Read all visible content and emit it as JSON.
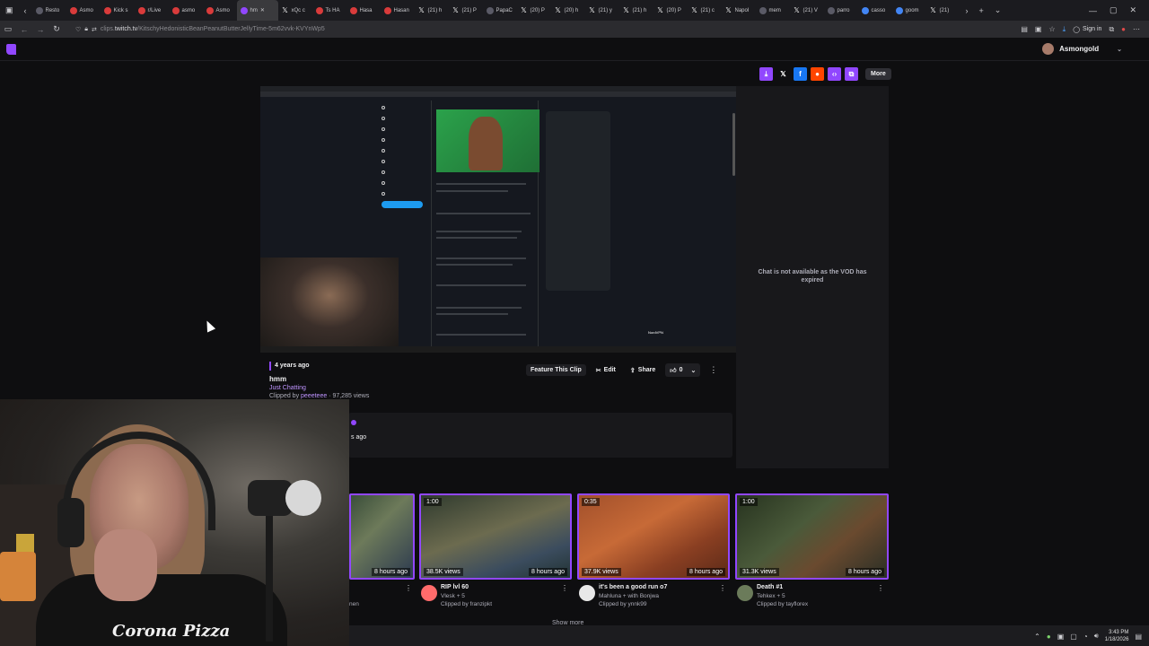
{
  "browser": {
    "tabs": [
      {
        "label": "Resto",
        "icon": "generic"
      },
      {
        "label": "Asmo",
        "icon": "youtube"
      },
      {
        "label": "Kick s",
        "icon": "youtube"
      },
      {
        "label": "r/Live",
        "icon": "youtube"
      },
      {
        "label": "asmo",
        "icon": "youtube"
      },
      {
        "label": "Asmo",
        "icon": "youtube"
      },
      {
        "label": "hm",
        "icon": "twitch",
        "active": true
      },
      {
        "label": "xQc c",
        "icon": "x"
      },
      {
        "label": "Ts HA",
        "icon": "youtube"
      },
      {
        "label": "Hasa",
        "icon": "youtube"
      },
      {
        "label": "Hasan",
        "icon": "youtube"
      },
      {
        "label": "(21) h",
        "icon": "x"
      },
      {
        "label": "(21) P",
        "icon": "x"
      },
      {
        "label": "PapaC",
        "icon": "generic"
      },
      {
        "label": "(20) P",
        "icon": "x"
      },
      {
        "label": "(20) h",
        "icon": "x"
      },
      {
        "label": "(21) y",
        "icon": "x"
      },
      {
        "label": "(21) h",
        "icon": "x"
      },
      {
        "label": "(20) P",
        "icon": "x"
      },
      {
        "label": "(21) c",
        "icon": "x"
      },
      {
        "label": "Napol",
        "icon": "x"
      },
      {
        "label": "mem",
        "icon": "generic"
      },
      {
        "label": "(21) V",
        "icon": "x"
      },
      {
        "label": "parro",
        "icon": "generic"
      },
      {
        "label": "casso",
        "icon": "google"
      },
      {
        "label": "goom",
        "icon": "google"
      },
      {
        "label": "(21)",
        "icon": "x"
      }
    ],
    "url_host": "clips.twitch.tv",
    "url_path": "/KitschyHedonisticBeanPeanutButterJellyTime-5m62vvk-KVYnWp5",
    "url_prefix": "clips.",
    "url_host_main": "twitch.tv",
    "sign_in_label": "Sign in"
  },
  "twitch": {
    "username": "Asmongold",
    "share_more_label": "More"
  },
  "clip": {
    "time_ago": "4 years ago",
    "title": "hmm",
    "category": "Just Chatting",
    "clipped_prefix": "Clipped by ",
    "clipper": "peeeteee",
    "views_text": " · 97,285 views",
    "actions": {
      "feature": "Feature This Clip",
      "edit": "Edit",
      "share": "Share",
      "likes": "0"
    }
  },
  "chat": {
    "message": "Chat is not available as the VOD has expired"
  },
  "comment": {
    "time_ago": "s ago"
  },
  "video": {
    "nordvpn": "NordVPN"
  },
  "clips": [
    {
      "duration": "",
      "views": "",
      "hours": "8 hours ago",
      "title": "",
      "streamer": "",
      "clipper": "nen"
    },
    {
      "duration": "1:00",
      "views": "38.5K views",
      "hours": "8 hours ago",
      "title": "RIP lvl 60",
      "streamer": "Vlesk + 5",
      "clipper": "Clipped by franzipkt"
    },
    {
      "duration": "0:35",
      "views": "37.9K views",
      "hours": "8 hours ago",
      "title": "it's been a good run o7",
      "streamer": "Mahluna + with Bonjwa",
      "clipper": "Clipped by ynnk99"
    },
    {
      "duration": "1:00",
      "views": "31.3K views",
      "hours": "8 hours ago",
      "title": "Death #1",
      "streamer": "Tehkex + 5",
      "clipper": "Clipped by tayflorex"
    }
  ],
  "show_more_label": "Show more",
  "webcam": {
    "shirt_text": "Corona Pizza"
  },
  "system": {
    "time": "3:43 PM",
    "date": "1/18/2026"
  },
  "colors": {
    "twitch_purple": "#9147ff",
    "page_bg": "#0e0e10",
    "panel_bg": "#18181b",
    "link_purple": "#bf94ff"
  }
}
